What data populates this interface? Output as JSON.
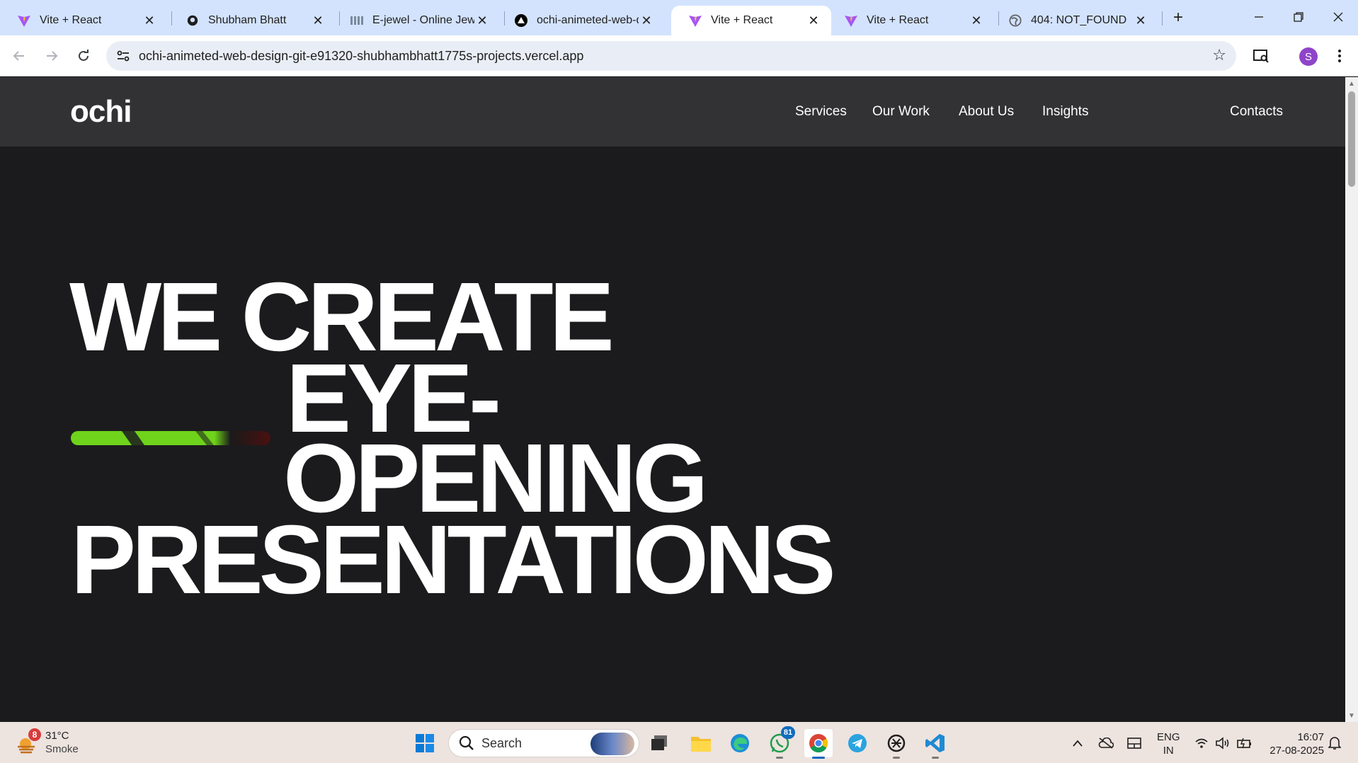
{
  "browser": {
    "tabs": [
      {
        "title": "Vite + React",
        "icon": "vite-icon",
        "active": false
      },
      {
        "title": "Shubham Bhatt",
        "icon": "github-icon",
        "active": false
      },
      {
        "title": "E-jewel - Online Jewel",
        "icon": "jewel-icon",
        "active": false
      },
      {
        "title": "ochi-animeted-web-d",
        "icon": "vercel-icon",
        "active": false
      },
      {
        "title": "Vite + React",
        "icon": "vite-icon",
        "active": true
      },
      {
        "title": "Vite + React",
        "icon": "vite-icon",
        "active": false
      },
      {
        "title": "404: NOT_FOUND",
        "icon": "globe-icon",
        "active": false
      }
    ],
    "url": "ochi-animeted-web-design-git-e91320-shubhambhatt1775s-projects.vercel.app",
    "profile_initial": "S"
  },
  "site": {
    "logo": "ochi",
    "nav": [
      "Services",
      "Our Work",
      "About Us",
      "Insights"
    ],
    "contact": "Contacts",
    "hero": {
      "line1": "WE CREATE",
      "line2": "EYE-",
      "line3": "OPENING",
      "line4": "PRESENTATIONS"
    },
    "accent_color": "#6fd31b",
    "background_color": "#1b1b1d"
  },
  "taskbar": {
    "weather": {
      "temp": "31°C",
      "condition": "Smoke",
      "badge": "8"
    },
    "search_label": "Search",
    "whatsapp_badge": "81",
    "language": {
      "line1": "ENG",
      "line2": "IN"
    },
    "time": "16:07",
    "date": "27-08-2025"
  }
}
